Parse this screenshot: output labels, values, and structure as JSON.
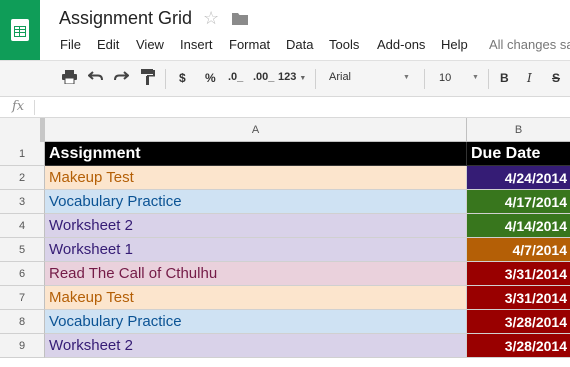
{
  "app": {
    "title": "Assignment Grid",
    "menu": [
      "File",
      "Edit",
      "View",
      "Insert",
      "Format",
      "Data",
      "Tools",
      "Add-ons",
      "Help"
    ],
    "save_status": "All changes sa",
    "brand_color": "#0f9d58"
  },
  "toolbar": {
    "print_icon": "print-icon",
    "undo_icon": "undo-icon",
    "redo_icon": "redo-icon",
    "paint_format_icon": "paint-format-icon",
    "currency": "$",
    "percent": "%",
    "decrease_decimals": ".0_",
    "increase_decimals": ".00_",
    "more_formats": "123",
    "font": "Arial",
    "font_size": "10",
    "bold": "B",
    "italic": "I",
    "strikethrough": "S"
  },
  "formula_bar": {
    "icon": "fx",
    "value": ""
  },
  "columns": [
    {
      "label": "A"
    },
    {
      "label": "B"
    }
  ],
  "rows": [
    {
      "num": "1",
      "assignment": "Assignment",
      "due": "Due Date",
      "header": true
    },
    {
      "num": "2",
      "assignment": "Makeup Test",
      "due": "4/24/2014",
      "a_bg": "#fce5cd",
      "a_fg": "#b45f06",
      "b_bg": "#351c75"
    },
    {
      "num": "3",
      "assignment": "Vocabulary Practice",
      "due": "4/17/2014",
      "a_bg": "#cfe2f3",
      "a_fg": "#0b5394",
      "b_bg": "#38761d"
    },
    {
      "num": "4",
      "assignment": "Worksheet 2",
      "due": "4/14/2014",
      "a_bg": "#d9d2e9",
      "a_fg": "#351c75",
      "b_bg": "#38761d"
    },
    {
      "num": "5",
      "assignment": "Worksheet 1",
      "due": "4/7/2014",
      "a_bg": "#d9d2e9",
      "a_fg": "#351c75",
      "b_bg": "#b45f06"
    },
    {
      "num": "6",
      "assignment": "Read The Call of Cthulhu",
      "due": "3/31/2014",
      "a_bg": "#ead1dc",
      "a_fg": "#741b47",
      "b_bg": "#990000"
    },
    {
      "num": "7",
      "assignment": "Makeup Test",
      "due": "3/31/2014",
      "a_bg": "#fce5cd",
      "a_fg": "#b45f06",
      "b_bg": "#990000"
    },
    {
      "num": "8",
      "assignment": "Vocabulary Practice",
      "due": "3/28/2014",
      "a_bg": "#cfe2f3",
      "a_fg": "#0b5394",
      "b_bg": "#990000"
    },
    {
      "num": "9",
      "assignment": "Worksheet 2",
      "due": "3/28/2014",
      "a_bg": "#d9d2e9",
      "a_fg": "#351c75",
      "b_bg": "#990000"
    }
  ]
}
